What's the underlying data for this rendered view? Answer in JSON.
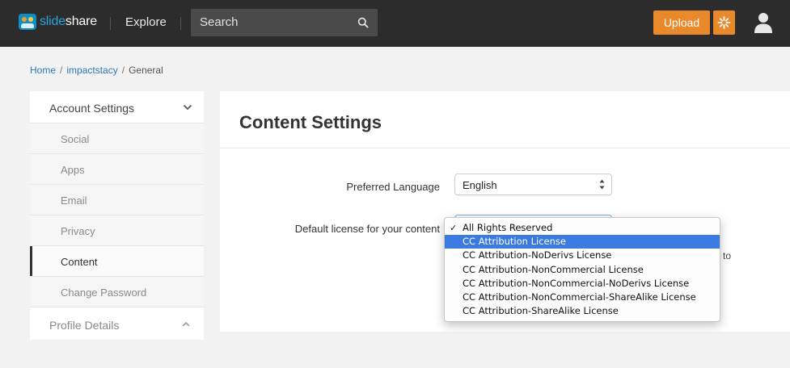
{
  "header": {
    "logo_text_a": "slide",
    "logo_text_b": "share",
    "explore_label": "Explore",
    "search_placeholder": "Search",
    "upload_label": "Upload",
    "brand_color": "#e8892b"
  },
  "breadcrumb": {
    "home": "Home",
    "user": "impactstacy",
    "current": "General",
    "separator": "/"
  },
  "sidebar": {
    "account_settings_label": "Account Settings",
    "items": [
      {
        "label": "Social",
        "active": false
      },
      {
        "label": "Apps",
        "active": false
      },
      {
        "label": "Email",
        "active": false
      },
      {
        "label": "Privacy",
        "active": false
      },
      {
        "label": "Content",
        "active": true
      },
      {
        "label": "Change Password",
        "active": false
      }
    ],
    "profile_details_label": "Profile Details"
  },
  "main": {
    "title": "Content Settings",
    "preferred_language_label": "Preferred Language",
    "preferred_language_value": "English",
    "default_license_label": "Default license for your content",
    "partial_text_to": "to"
  },
  "license_dropdown": {
    "selected_index": 0,
    "highlighted_index": 1,
    "options": [
      "All Rights Reserved",
      "CC Attribution License",
      "CC Attribution-NoDerivs License",
      "CC Attribution-NonCommercial License",
      "CC Attribution-NonCommercial-NoDerivs License",
      "CC Attribution-NonCommercial-ShareAlike License",
      "CC Attribution-ShareAlike License"
    ],
    "check_mark": "✓",
    "highlight_color": "#3b7ae0"
  }
}
